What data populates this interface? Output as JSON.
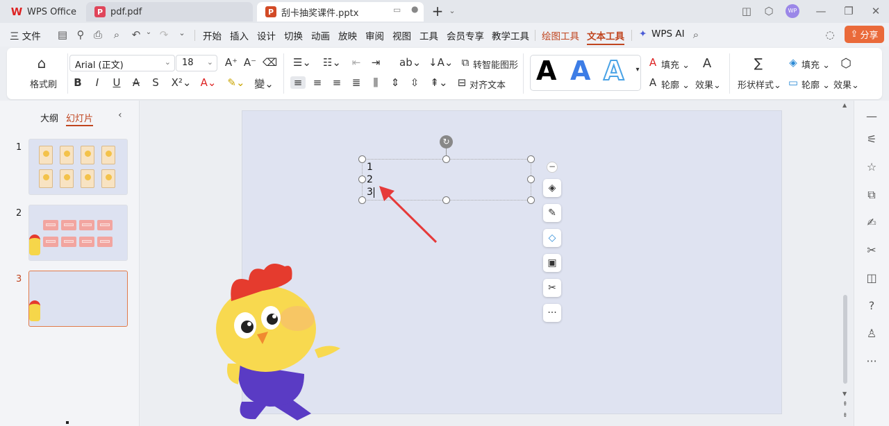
{
  "tabs": [
    {
      "label": "WPS Office"
    },
    {
      "label": "pdf.pdf"
    },
    {
      "label": "刮卡抽奖课件.pptx"
    }
  ],
  "avatar": "WP",
  "menu": {
    "file": "三 文件",
    "items": [
      "开始",
      "插入",
      "设计",
      "切换",
      "动画",
      "放映",
      "审阅",
      "视图",
      "工具",
      "会员专享",
      "教学工具"
    ],
    "draw_tools": "绘图工具",
    "text_tools": "文本工具",
    "wps_ai": "WPS AI",
    "share": "分享"
  },
  "ribbon": {
    "format_brush": "格式刷",
    "font_name": "Arial (正文)",
    "font_size": "18",
    "smart_shape": "转智能图形",
    "align_text": "对齐文本",
    "fill": "填充",
    "outline": "轮廓",
    "effect": "效果",
    "shape_style": "形状样式",
    "fill2": "填充",
    "outline2": "轮廓",
    "effect2": "效果",
    "style_letters": [
      "A",
      "A",
      "A"
    ]
  },
  "panel": {
    "outline_tab": "大纲",
    "slides_tab": "幻灯片",
    "slide_numbers": [
      "1",
      "2",
      "3"
    ]
  },
  "textbox": {
    "lines": [
      "1",
      "2",
      "3"
    ]
  }
}
